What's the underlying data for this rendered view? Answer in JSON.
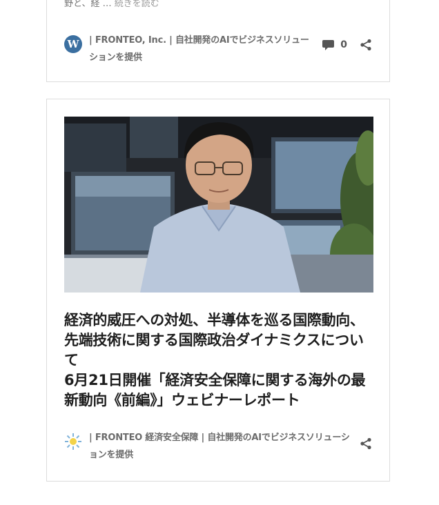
{
  "card1": {
    "excerpt_text": "野と、経 …",
    "read_more": "続きを読む",
    "site_icon": "wordpress-icon",
    "byline": "| FRONTEO, Inc. | 自社開発のAIでビジネスソリューションを提供",
    "comment_count": "0",
    "comment_icon": "speech-bubble-icon",
    "share_icon": "share-icon"
  },
  "card2": {
    "thumbnail": "photo of man with glasses in light blue shirt in office with monitors",
    "title_line1": "経済的威圧への対処、半導体を巡る国際動向、先端技術に関する国際政治ダイナミクスについて",
    "title_line2": "6月21日開催「経済安全保障に関する海外の最新動向《前編》」ウェビナーレポート",
    "site_icon": "sun-burst-icon",
    "byline": "| FRONTEO 経済安全保障 | 自社開発のAIでビジネスソリューションを提供",
    "share_icon": "share-icon"
  }
}
